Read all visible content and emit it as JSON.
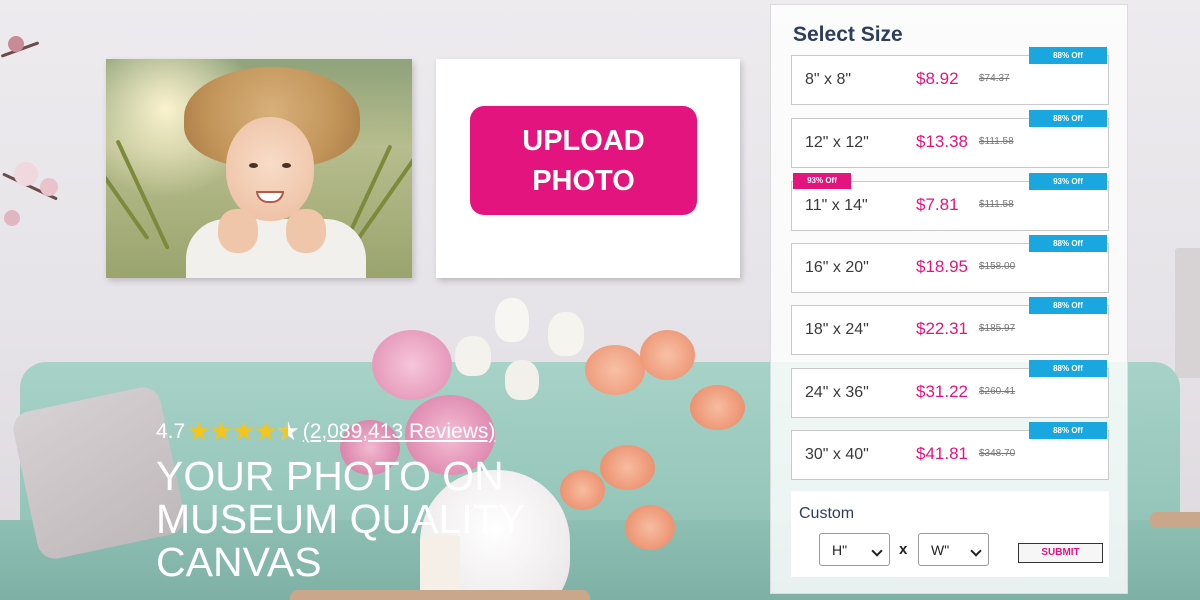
{
  "upload": {
    "label": "UPLOAD\nPHOTO"
  },
  "hero": {
    "rating": "4.7",
    "stars": "★★★★",
    "half_star": "★",
    "reviews": "(2,089,413 Reviews)",
    "title": "YOUR PHOTO ON\nMUSEUM QUALITY\nCANVAS"
  },
  "size_panel": {
    "title": "Select Size",
    "options": [
      {
        "size": "8\" x 8\"",
        "price": "$8.92",
        "was": "$74.37",
        "badge": "88% Off",
        "left_badge": ""
      },
      {
        "size": "12\" x 12\"",
        "price": "$13.38",
        "was": "$111.58",
        "badge": "88% Off",
        "left_badge": ""
      },
      {
        "size": "11\" x 14\"",
        "price": "$7.81",
        "was": "$111.58",
        "badge": "93% Off",
        "left_badge": "93% Off"
      },
      {
        "size": "16\" x 20\"",
        "price": "$18.95",
        "was": "$158.00",
        "badge": "88% Off",
        "left_badge": ""
      },
      {
        "size": "18\" x 24\"",
        "price": "$22.31",
        "was": "$185.97",
        "badge": "88% Off",
        "left_badge": ""
      },
      {
        "size": "24\" x 36\"",
        "price": "$31.22",
        "was": "$260.41",
        "badge": "88% Off",
        "left_badge": ""
      },
      {
        "size": "30\" x 40\"",
        "price": "$41.81",
        "was": "$348.70",
        "badge": "88% Off",
        "left_badge": ""
      }
    ],
    "custom": {
      "label": "Custom",
      "height_value": "H\"",
      "width_value": "W\"",
      "times": "x",
      "submit": "SUBMIT"
    }
  },
  "colors": {
    "accent": "#e4147f",
    "badge_blue": "#1aa7e0",
    "panel_title": "#2c3e5c",
    "star": "#f5c518"
  }
}
